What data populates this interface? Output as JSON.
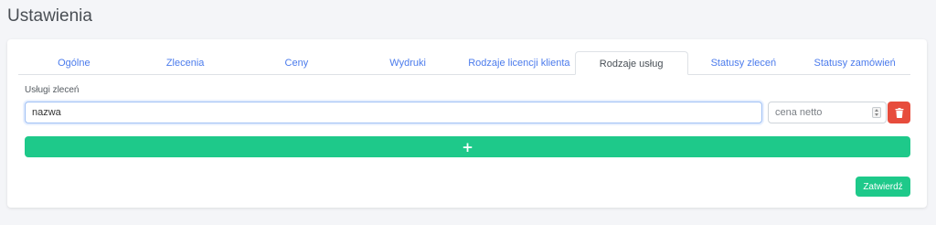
{
  "page": {
    "title": "Ustawienia"
  },
  "tabs": [
    {
      "label": "Ogólne",
      "active": false
    },
    {
      "label": "Zlecenia",
      "active": false
    },
    {
      "label": "Ceny",
      "active": false
    },
    {
      "label": "Wydruki",
      "active": false
    },
    {
      "label": "Rodzaje licencji klienta",
      "active": false
    },
    {
      "label": "Rodzaje usług",
      "active": true
    },
    {
      "label": "Statusy zleceń",
      "active": false
    },
    {
      "label": "Statusy zamówień",
      "active": false
    }
  ],
  "services": {
    "section_label": "Usługi zleceń",
    "name_placeholder": "nazwa",
    "price_placeholder": "cena netto",
    "add_label": "+",
    "delete_icon": "trash-icon"
  },
  "actions": {
    "submit_label": "Zatwierdź"
  },
  "colors": {
    "accent_link": "#4b7bec",
    "success": "#1ec98a",
    "danger": "#e74c3c",
    "focus_border": "#9ec0f5"
  }
}
